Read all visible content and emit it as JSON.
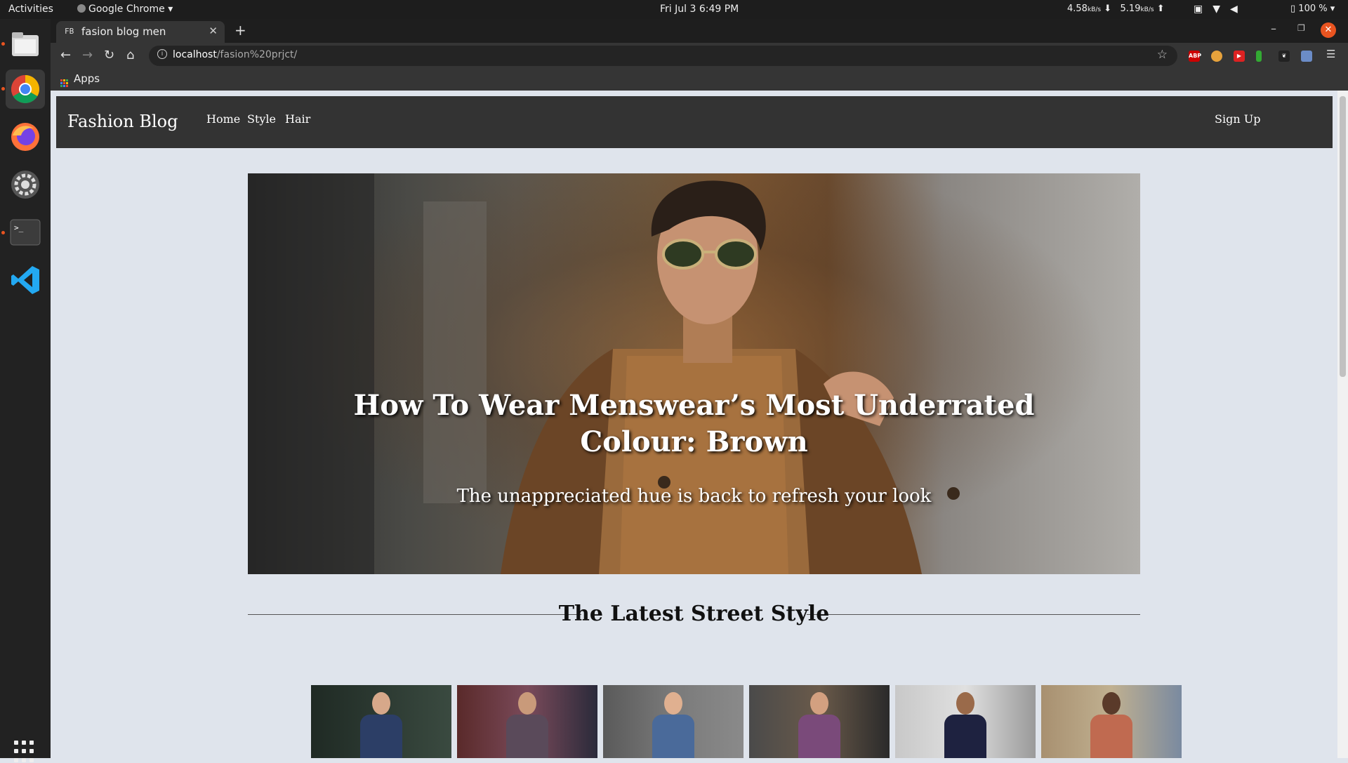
{
  "desktop": {
    "activities": "Activities",
    "app_menu": "Google Chrome",
    "clock": "Fri Jul 3   6:49 PM",
    "net_down": "4.58",
    "net_down_unit": "kB/s",
    "net_up": "5.19",
    "net_up_unit": "kB/s",
    "battery": "100 %",
    "dock": [
      "files-icon",
      "chrome-icon",
      "firefox-icon",
      "settings-icon",
      "terminal-icon",
      "vscode-icon"
    ]
  },
  "browser": {
    "tab_title": "fasion blog men",
    "tab_favicon": "FB",
    "url_host": "localhost",
    "url_path": "/fasion%20prjct/",
    "bookmarks_apps": "Apps",
    "extensions": [
      "ABP",
      "emoji",
      "YT",
      "pin",
      "leaf",
      "card"
    ],
    "colors": {
      "tabstrip": "#1e1e1e",
      "toolbar": "#353535",
      "close_button": "#e95420"
    }
  },
  "site": {
    "brand": "Fashion Blog",
    "nav": {
      "home": "Home",
      "style": "Style",
      "hair": "Hair",
      "signup": "Sign Up"
    },
    "hero": {
      "title": "How To Wear Menswear’s Most Underrated Colour: Brown",
      "subtitle": "The unappreciated hue is back to refresh your look"
    },
    "section_title": "The Latest Street Style",
    "gallery_count": 6,
    "colors": {
      "navbar": "#333333",
      "page_bg": "#dfe4ec"
    }
  }
}
